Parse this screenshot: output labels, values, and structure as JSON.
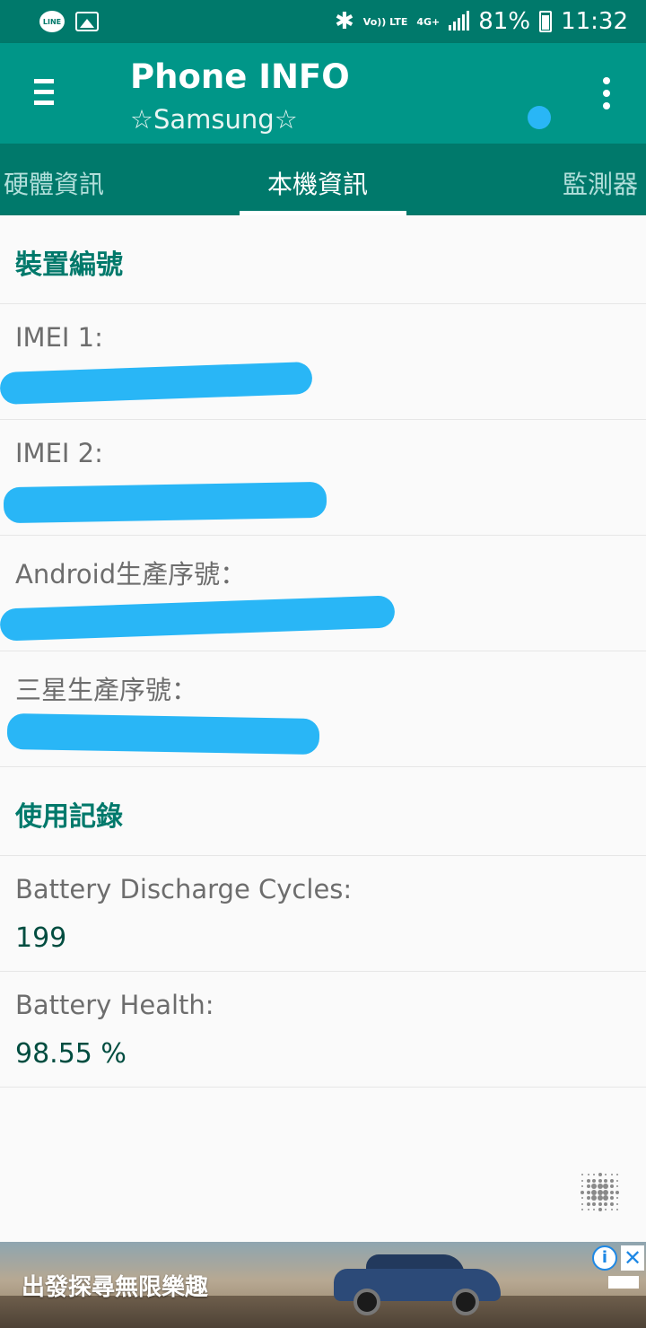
{
  "status_bar": {
    "line_icon_text": "LINE",
    "volte_text": "Vo)) LTE",
    "network_text": "4G+",
    "battery_percent": "81%",
    "time": "11:32"
  },
  "app_bar": {
    "title": "Phone INFO",
    "subtitle": "☆Samsung☆",
    "indicator_color": "#29b6f6"
  },
  "tabs": [
    {
      "label": "硬體資訊",
      "selected": false
    },
    {
      "label": "本機資訊",
      "selected": true
    },
    {
      "label": "監測器",
      "selected": false
    }
  ],
  "sections": [
    {
      "header": "裝置編號",
      "items": [
        {
          "label": "IMEI 1:",
          "value": "",
          "redacted": true
        },
        {
          "label": "IMEI 2:",
          "value": "",
          "redacted": true
        },
        {
          "label": "Android生產序號：",
          "value": "",
          "redacted": true
        },
        {
          "label": "三星生產序號：",
          "value": "",
          "redacted": true
        }
      ]
    },
    {
      "header": "使用記錄",
      "items": [
        {
          "label": "Battery Discharge Cycles:",
          "value": "199"
        },
        {
          "label": "Battery Health:",
          "value": "98.55 %"
        }
      ]
    }
  ],
  "ad": {
    "text": "出發探尋無限樂趣",
    "info_glyph": "i",
    "close_glyph": "✕"
  },
  "icons": {
    "menu": "hamburger-menu-icon",
    "more": "more-vert-icon",
    "floating": "dot-grid-icon",
    "bluetooth": "bluetooth-icon",
    "signal": "signal-bars-icon",
    "battery": "battery-icon",
    "gallery": "image-icon"
  },
  "colors": {
    "primary": "#009688",
    "primary_dark": "#00796b",
    "accent_text": "#00796b",
    "value_text": "#004d40",
    "redaction": "#29b6f6"
  }
}
